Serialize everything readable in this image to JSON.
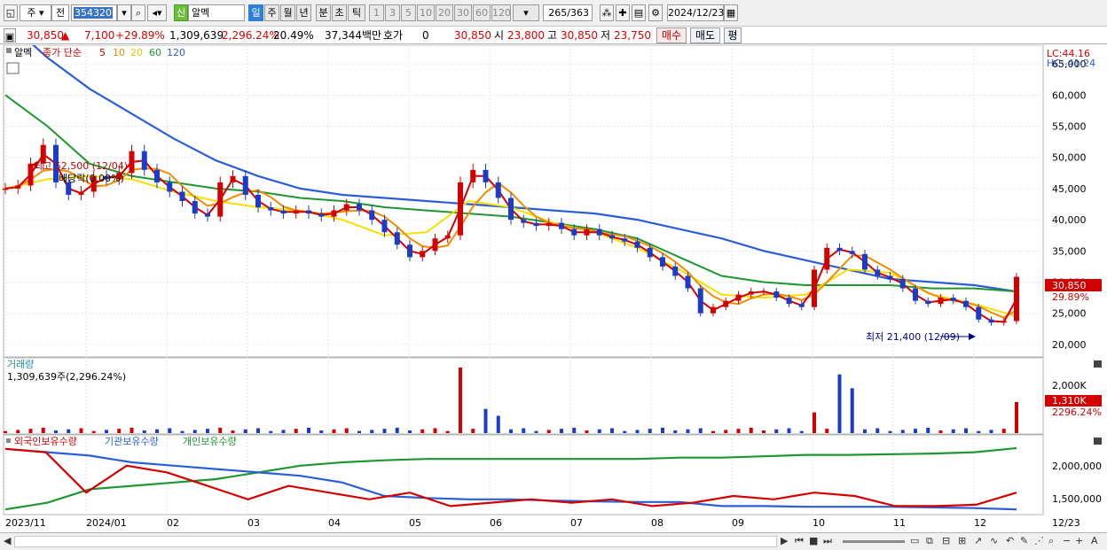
{
  "toolbar": {
    "type_select": "주",
    "market_select": "전",
    "code": "354320",
    "badge": "신",
    "name": "알멕",
    "periods": [
      "일",
      "주",
      "월",
      "년",
      "분",
      "초",
      "틱"
    ],
    "active_period": "일",
    "minute_options": [
      "1",
      "3",
      "5",
      "10",
      "20",
      "30",
      "60",
      "120"
    ],
    "count": "265",
    "count_total": "/363",
    "date": "2024/12/23"
  },
  "quote": {
    "price": "30,850",
    "change_arrow": "▲",
    "change": "7,100",
    "change_pct": "+29.89%",
    "volume": "1,309,639",
    "volume_ratio": "2,296.24%",
    "turnover_ratio": "20.49%",
    "amount": "37,344백만",
    "hoga_label": "호가",
    "hoga_value": "0",
    "current": "30,850",
    "open_label": "시",
    "open": "23,800",
    "high_label": "고",
    "high": "30,850",
    "low_label": "저",
    "low": "23,750",
    "buy_button": "매수",
    "sell_button": "매도",
    "eval_button": "평"
  },
  "price_panel": {
    "stock_tag": "알멕",
    "legend_prefix": "종가 단순",
    "ma_legend": [
      {
        "label": "5",
        "color": "#d40000"
      },
      {
        "label": "10",
        "color": "#f08c00"
      },
      {
        "label": "20",
        "color": "#f5e000"
      },
      {
        "label": "60",
        "color": "#1e9632"
      },
      {
        "label": "120",
        "color": "#2a5ed8"
      }
    ],
    "lc": "LC:44.16",
    "hc": "HC:-41.24",
    "high_note": "최고 52,500 (12/04)",
    "dividend_note": "배당락(0.00%)",
    "low_note": "최저 21,400 (12/09)",
    "last_price_tag": "30,850",
    "last_pct_tag": "29.89%"
  },
  "volume_panel": {
    "title": "거래량",
    "value": "1,309,639주(2,296.24%)",
    "axis_label": "2,000K",
    "last_tag": "1,310K",
    "last_pct": "2296.24%"
  },
  "holding_panel": {
    "legend": [
      {
        "label": "외국인보유수량",
        "color": "#d40000"
      },
      {
        "label": "기관보유수량",
        "color": "#2a5ed8"
      },
      {
        "label": "개인보유수량",
        "color": "#1e9632"
      }
    ],
    "axis_labels": [
      "2,000,000",
      "1,500,000"
    ]
  },
  "x_axis": [
    "2023/11",
    "2024/01",
    "02",
    "03",
    "04",
    "05",
    "06",
    "07",
    "08",
    "09",
    "10",
    "11",
    "12",
    "12/23"
  ],
  "chart_data": {
    "type": "candlestick",
    "y_ticks": [
      65000,
      60000,
      55000,
      50000,
      45000,
      40000,
      35000,
      30000,
      25000,
      20000
    ],
    "y_labels": [
      "65,000",
      "60,000",
      "55,000",
      "50,000",
      "45,000",
      "40,000",
      "35,000",
      "30,000",
      "25,000",
      "20,000"
    ],
    "close_series": [
      45000,
      45500,
      49000,
      52000,
      46000,
      44000,
      44500,
      47000,
      46500,
      47500,
      51000,
      48000,
      46000,
      44500,
      43000,
      41000,
      40500,
      46000,
      47000,
      44000,
      42000,
      41500,
      41000,
      41500,
      41000,
      40500,
      41500,
      42500,
      41500,
      40000,
      38000,
      36000,
      34000,
      35000,
      37000,
      37500,
      46000,
      48000,
      46000,
      43500,
      40000,
      39500,
      39000,
      39500,
      38500,
      37500,
      38500,
      37500,
      37000,
      36500,
      35500,
      34000,
      32500,
      31000,
      29000,
      25000,
      26000,
      27000,
      28000,
      28500,
      28500,
      27500,
      26500,
      26000,
      32000,
      35500,
      35000,
      34500,
      32000,
      31000,
      30500,
      29000,
      27000,
      26500,
      27500,
      27000,
      26000,
      24000,
      23500,
      23750,
      30850
    ],
    "ma120": [
      72000,
      66000,
      61000,
      57000,
      53000,
      49500,
      47000,
      45000,
      44000,
      43500,
      43000,
      42500,
      42000,
      41500,
      41000,
      40000,
      38500,
      37000,
      35000,
      33500,
      32000,
      30500,
      30000,
      29500,
      28500
    ],
    "ma60": [
      60000,
      55000,
      49000,
      47000,
      46000,
      45000,
      44500,
      43500,
      43000,
      42000,
      41500,
      41000,
      40500,
      39500,
      38500,
      37000,
      34000,
      31000,
      30000,
      29500,
      29500,
      29500,
      29000,
      29000,
      28500
    ],
    "ma20": [
      45000,
      46500,
      47000,
      46500,
      44500,
      43000,
      42000,
      41500,
      40000,
      37500,
      38000,
      43000,
      42000,
      39500,
      38000,
      35500,
      32000,
      28000,
      27500,
      28000,
      32000,
      31500,
      28000,
      26500,
      24500
    ],
    "foreign": [
      0.95,
      0.9,
      0.3,
      0.7,
      0.6,
      0.4,
      0.2,
      0.4,
      0.3,
      0.2,
      0.3,
      0.1,
      0.15,
      0.2,
      0.15,
      0.2,
      0.1,
      0.15,
      0.25,
      0.2,
      0.3,
      0.25,
      0.1,
      0.1,
      0.12,
      0.3
    ],
    "institution": [
      0.95,
      0.9,
      0.85,
      0.75,
      0.7,
      0.65,
      0.6,
      0.55,
      0.45,
      0.25,
      0.22,
      0.2,
      0.2,
      0.18,
      0.17,
      0.16,
      0.16,
      0.1,
      0.1,
      0.09,
      0.09,
      0.09,
      0.08,
      0.07,
      0.05
    ],
    "individual": [
      0.05,
      0.15,
      0.35,
      0.4,
      0.45,
      0.5,
      0.6,
      0.7,
      0.75,
      0.78,
      0.8,
      0.8,
      0.8,
      0.8,
      0.8,
      0.8,
      0.82,
      0.82,
      0.84,
      0.86,
      0.86,
      0.87,
      0.88,
      0.9,
      0.96
    ]
  }
}
